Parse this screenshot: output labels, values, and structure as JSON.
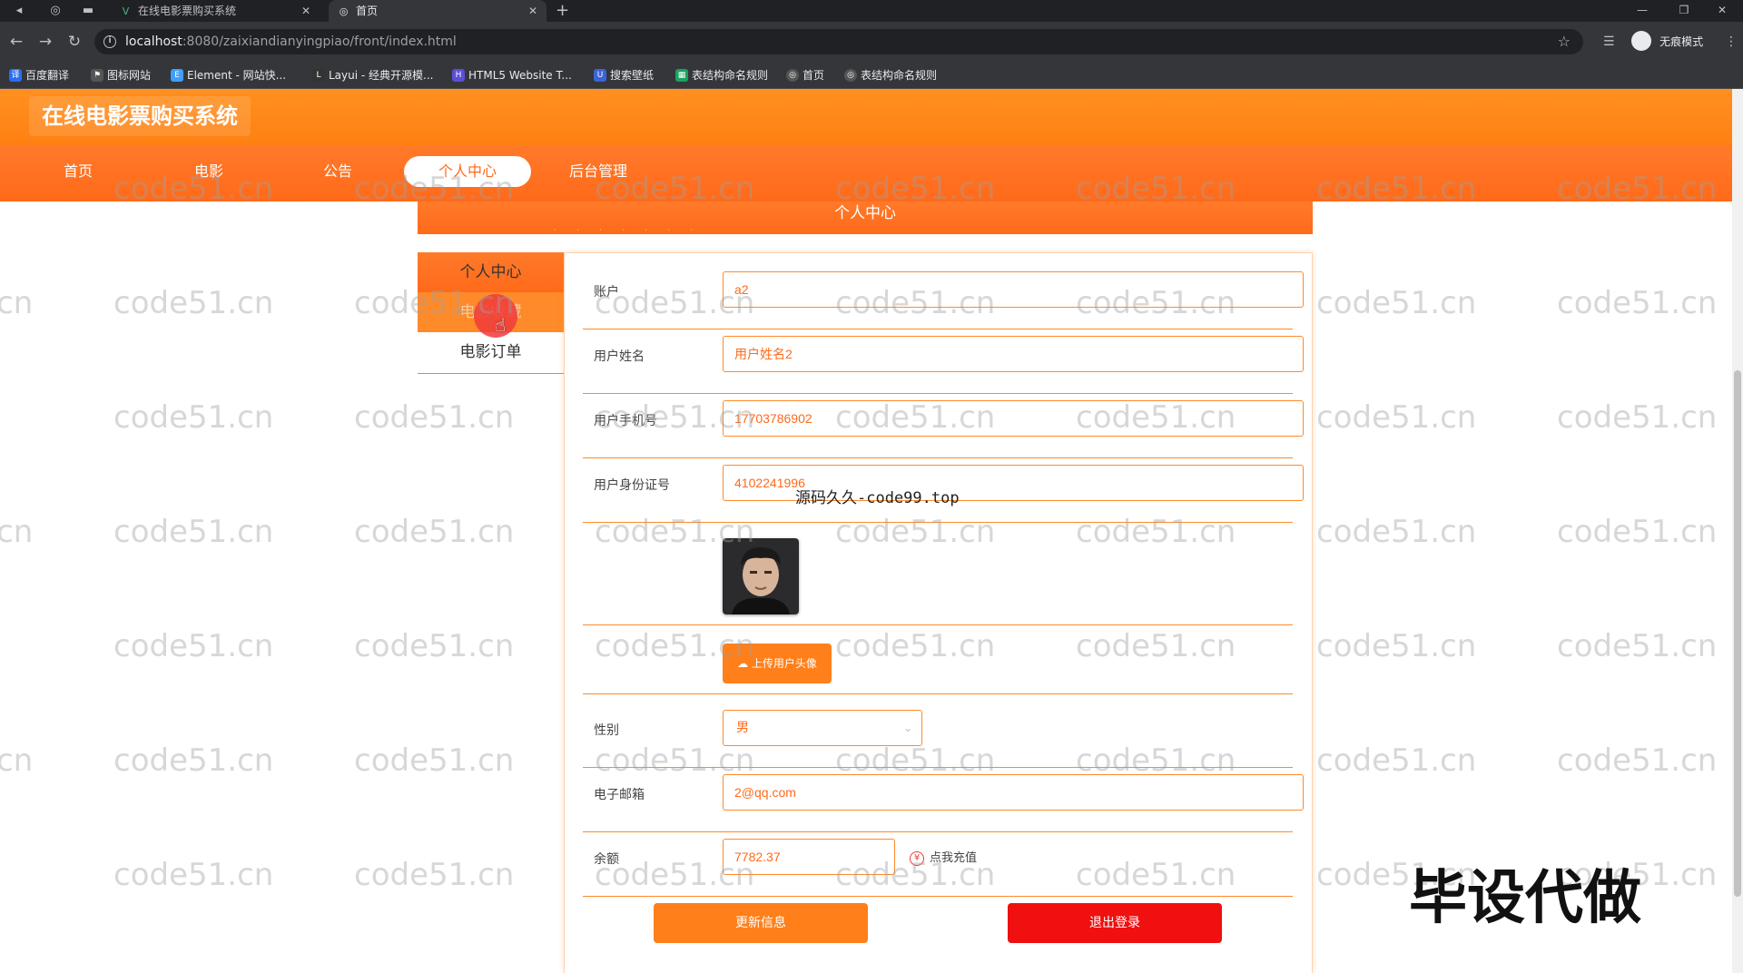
{
  "browser": {
    "tabs": [
      {
        "title": "在线电影票购买系统"
      },
      {
        "title": "首页"
      }
    ],
    "url_host": "localhost",
    "url_rest": ":8080/zaixiandianyingpiao/front/index.html",
    "incognito_label": "无痕模式",
    "bookmarks": [
      {
        "label": "百度翻译",
        "color": "#2a6df4"
      },
      {
        "label": "图标网站",
        "color": "#555555"
      },
      {
        "label": "Element - 网站快...",
        "color": "#409eff"
      },
      {
        "label": "Layui - 经典开源模...",
        "color": "#333333"
      },
      {
        "label": "HTML5 Website T...",
        "color": "#5b4fd8"
      },
      {
        "label": "搜索壁纸",
        "color": "#3b64d6"
      },
      {
        "label": "表结构命名规则",
        "color": "#1aa260"
      },
      {
        "label": "首页",
        "color": "#555555"
      },
      {
        "label": "表结构命名规则",
        "color": "#555555"
      }
    ]
  },
  "site": {
    "title": "在线电影票购买系统",
    "nav": [
      "首页",
      "电影",
      "公告",
      "个人中心",
      "后台管理"
    ],
    "banner_title": "个人中心",
    "banner_dots": "· · · · · · ·"
  },
  "side_menu": {
    "items": [
      "个人中心",
      "电影收藏",
      "电影订单"
    ]
  },
  "form": {
    "account": {
      "label": "账户",
      "value": "a2"
    },
    "name": {
      "label": "用户姓名",
      "value": "用户姓名2"
    },
    "phone": {
      "label": "用户手机号",
      "value": "17703786902"
    },
    "idcard": {
      "label": "用户身份证号",
      "value": "4102241996"
    },
    "upload_label": "上传用户头像",
    "gender": {
      "label": "性别",
      "value": "男"
    },
    "email": {
      "label": "电子邮箱",
      "value": "2@qq.com"
    },
    "balance": {
      "label": "余额",
      "value": "7782.37"
    },
    "recharge_label": "点我充值",
    "update_button": "更新信息",
    "logout_button": "退出登录"
  },
  "overlays": {
    "watermark": "code51.cn",
    "source_text": "源码久久-code99.top",
    "corner_text": "毕设代做"
  },
  "colors": {
    "brand_orange": "#ff7f1a",
    "logout_red": "#f01010"
  }
}
